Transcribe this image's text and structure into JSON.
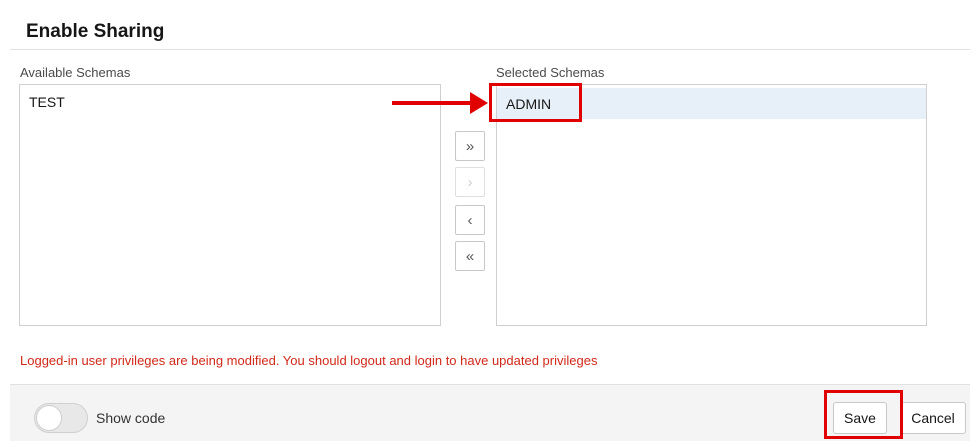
{
  "dialog": {
    "title": "Enable Sharing"
  },
  "available": {
    "label": "Available Schemas",
    "items": [
      "TEST"
    ]
  },
  "selected": {
    "label": "Selected Schemas",
    "items": [
      "ADMIN"
    ]
  },
  "shuttle": {
    "move_all": "»",
    "move_selected": "›",
    "remove_selected": "‹",
    "remove_all": "«"
  },
  "warning": "Logged-in user privileges are being modified. You should logout and login to have updated privileges",
  "footer": {
    "show_code_label": "Show code",
    "show_code_on": false,
    "save_label": "Save",
    "cancel_label": "Cancel"
  },
  "colors": {
    "annotation": "#e00000",
    "warning": "#d1291a",
    "selection": "#e7f0f8"
  }
}
